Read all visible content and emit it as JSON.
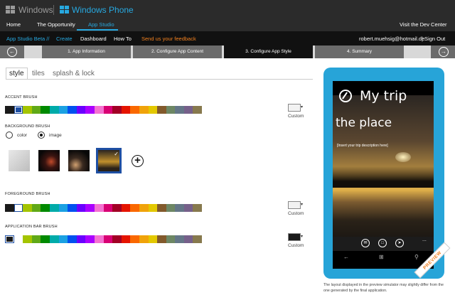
{
  "brand": {
    "windows": "Windows",
    "windows_phone": "Windows Phone"
  },
  "nav": {
    "home": "Home",
    "opportunity": "The Opportunity",
    "app_studio": "App Studio",
    "dev_center": "Visit the Dev Center"
  },
  "studio": {
    "title": "App Studio Beta //",
    "create": "Create",
    "dashboard": "Dashboard",
    "howto": "How To",
    "feedback": "Send us your feedback",
    "user": "robert.muehsig@hotmail.de",
    "signout": "| Sign Out"
  },
  "steps": [
    {
      "label": "1. App Information"
    },
    {
      "label": "2. Configure App Content"
    },
    {
      "label": "3. Configure App Style"
    },
    {
      "label": "4. Summary"
    }
  ],
  "tabs": {
    "style": "style",
    "tiles": "tiles",
    "splash": "splash & lock"
  },
  "sections": {
    "accent": "ACCENT BRUSH",
    "background": "BACKGROUND BRUSH",
    "foreground": "FOREGROUND BRUSH",
    "appbar": "APPLICATION BAR BRUSH"
  },
  "custom_label": "Custom",
  "custom_dropdown": "▾",
  "background_options": {
    "color": "color",
    "image": "image",
    "selected": "image"
  },
  "add_glyph": "+",
  "palette": [
    "#1a1a1a",
    "#ffffff",
    "#a4c400",
    "#60a917",
    "#008a00",
    "#00aba9",
    "#1ba1e2",
    "#0050ef",
    "#6a00ff",
    "#aa00ff",
    "#f472d0",
    "#d80073",
    "#a20025",
    "#e51400",
    "#fa6800",
    "#f0a30a",
    "#e3c800",
    "#825a2c",
    "#6d8764",
    "#647687",
    "#76608a",
    "#87794e"
  ],
  "accent_palette": [
    "#1a1a1a",
    "#1e4fa3",
    "#a4c400",
    "#60a917",
    "#008a00",
    "#00aba9",
    "#1ba1e2",
    "#0050ef",
    "#6a00ff",
    "#aa00ff",
    "#f472d0",
    "#d80073",
    "#a20025",
    "#e51400",
    "#fa6800",
    "#f0a30a",
    "#e3c800",
    "#825a2c",
    "#6d8764",
    "#647687",
    "#76608a",
    "#87794e"
  ],
  "selected": {
    "accent": 1,
    "foreground": 1,
    "appbar": 0
  },
  "phone": {
    "app_title": "My trip",
    "heading": "the place",
    "description": "[Insert your trip description here]",
    "more": "...",
    "preview": "PREVIEW"
  },
  "disclaimer": "The layout displayed in the preview simulator may slightly differ from the one generated by the final application."
}
